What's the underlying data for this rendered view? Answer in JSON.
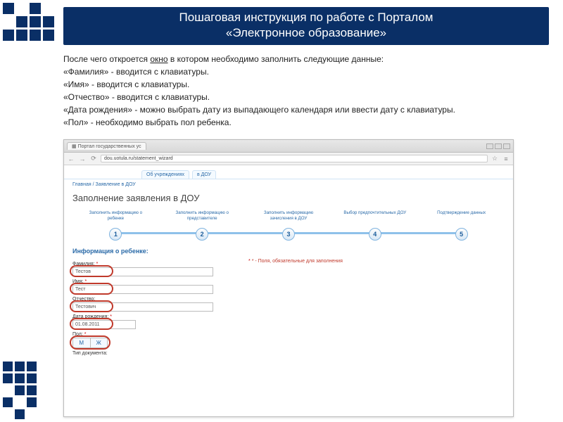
{
  "banner": {
    "line1": "Пошаговая инструкция по работе с Порталом",
    "line2": "«Электронное образование»"
  },
  "instructions": {
    "line1_pre": "После чего откроется ",
    "line1_und": "окно",
    "line1_post": " в котором необходимо заполнить следующие данные:",
    "line2": "«Фамилия» - вводится с клавиатуры.",
    "line3": "«Имя» - вводится с клавиатуры.",
    "line4": "«Отчество» - вводится с клавиатуры.",
    "line5": "«Дата рождения» - можно выбрать дату из выпадающего календаря или ввести дату с клавиатуры.",
    "line6": "«Пол» - необходимо выбрать пол ребенка."
  },
  "browser": {
    "tab_title": "Портал государственных ус",
    "url": "dou.uotula.ru/statement_wizard",
    "site_tabs": [
      "Об учреждениях",
      "в ДОУ"
    ],
    "breadcrumb": "Главная / Заявление в ДОУ",
    "page_title": "Заполнение заявления в ДОУ",
    "steps": [
      {
        "n": "1",
        "label": "Заполнить информацию о ребенке"
      },
      {
        "n": "2",
        "label": "Заполнить информацию о представителе"
      },
      {
        "n": "3",
        "label": "Заполнить информацию зачисления в ДОУ"
      },
      {
        "n": "4",
        "label": "Выбор предпочтительных ДОУ"
      },
      {
        "n": "5",
        "label": "Подтверждение данных"
      }
    ],
    "section_title": "Информация о ребенке:",
    "fields": {
      "lastname_label": "Фамилия:",
      "lastname_value": "Тестов",
      "firstname_label": "Имя:",
      "firstname_value": "Тест",
      "middlename_label": "Отчество:",
      "middlename_value": "Тестович",
      "dob_label": "Дата рождения:",
      "dob_value": "01.08.2011",
      "gender_label": "Пол:",
      "gender_m": "М",
      "gender_f": "Ж",
      "doc_type_label": "Тип документа:"
    },
    "required_hint": "* - Поля, обязательные для заполнения"
  }
}
